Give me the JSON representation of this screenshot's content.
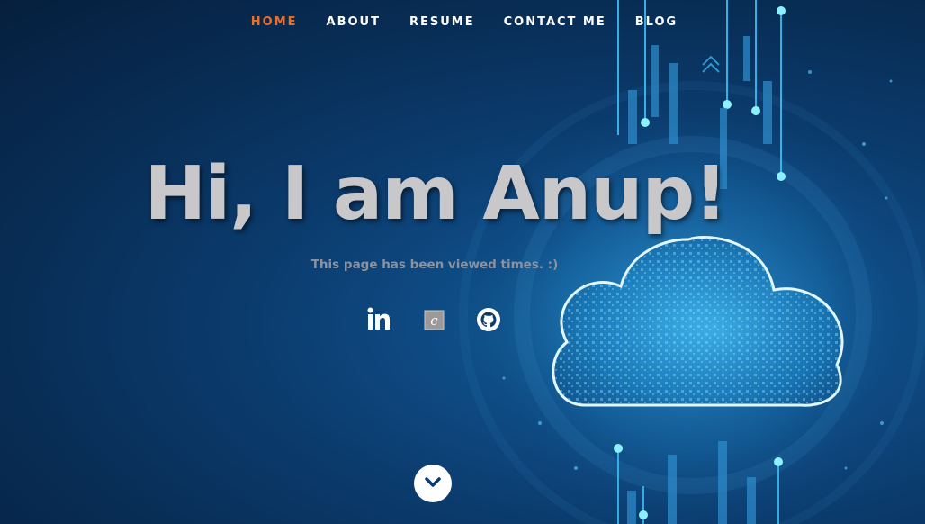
{
  "nav": {
    "items": [
      {
        "label": "HOME",
        "active": true
      },
      {
        "label": "ABOUT",
        "active": false
      },
      {
        "label": "RESUME",
        "active": false
      },
      {
        "label": "CONTACT ME",
        "active": false
      },
      {
        "label": "BLOG",
        "active": false
      }
    ],
    "active_color": "#e8702a",
    "text_color": "#ffffff"
  },
  "hero": {
    "headline": "Hi, I am Anup!",
    "views_prefix": "This page has been viewed",
    "views_count": "",
    "views_suffix": "times. :)",
    "background_color": "#0b3b6d"
  },
  "social": {
    "icons": [
      {
        "name": "linkedin-icon"
      },
      {
        "name": "credly-icon",
        "glyph": "c"
      },
      {
        "name": "github-icon"
      }
    ]
  },
  "scroll_button": {
    "icon": "chevron-down-icon"
  }
}
